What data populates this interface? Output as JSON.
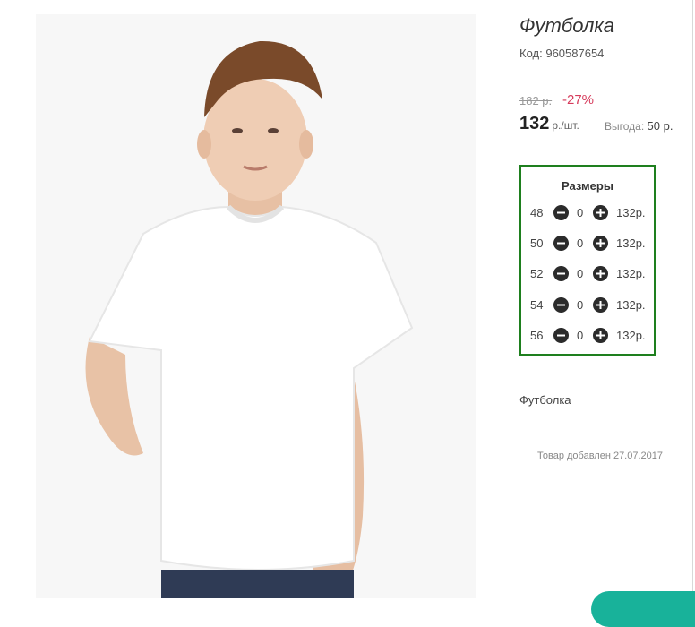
{
  "product": {
    "title": "Футболка",
    "code_label": "Код:",
    "code": "960587654",
    "old_price": "182 р.",
    "discount": "-27%",
    "price": "132",
    "unit": "р./шт.",
    "savings_label": "Выгода:",
    "savings_value": "50 р."
  },
  "sizes": {
    "title": "Размеры",
    "rows": [
      {
        "size": "48",
        "qty": "0",
        "price": "132р."
      },
      {
        "size": "50",
        "qty": "0",
        "price": "132р."
      },
      {
        "size": "52",
        "qty": "0",
        "price": "132р."
      },
      {
        "size": "54",
        "qty": "0",
        "price": "132р."
      },
      {
        "size": "56",
        "qty": "0",
        "price": "132р."
      }
    ]
  },
  "description": "Футболка",
  "added_text": "Товар добавлен 27.07.2017",
  "icons": {
    "minus": "minus-circle-icon",
    "plus": "plus-circle-icon"
  },
  "colors": {
    "discount": "#d63b5b",
    "sizes_border": "#1e7f1e",
    "accent_button": "#18b29a"
  }
}
